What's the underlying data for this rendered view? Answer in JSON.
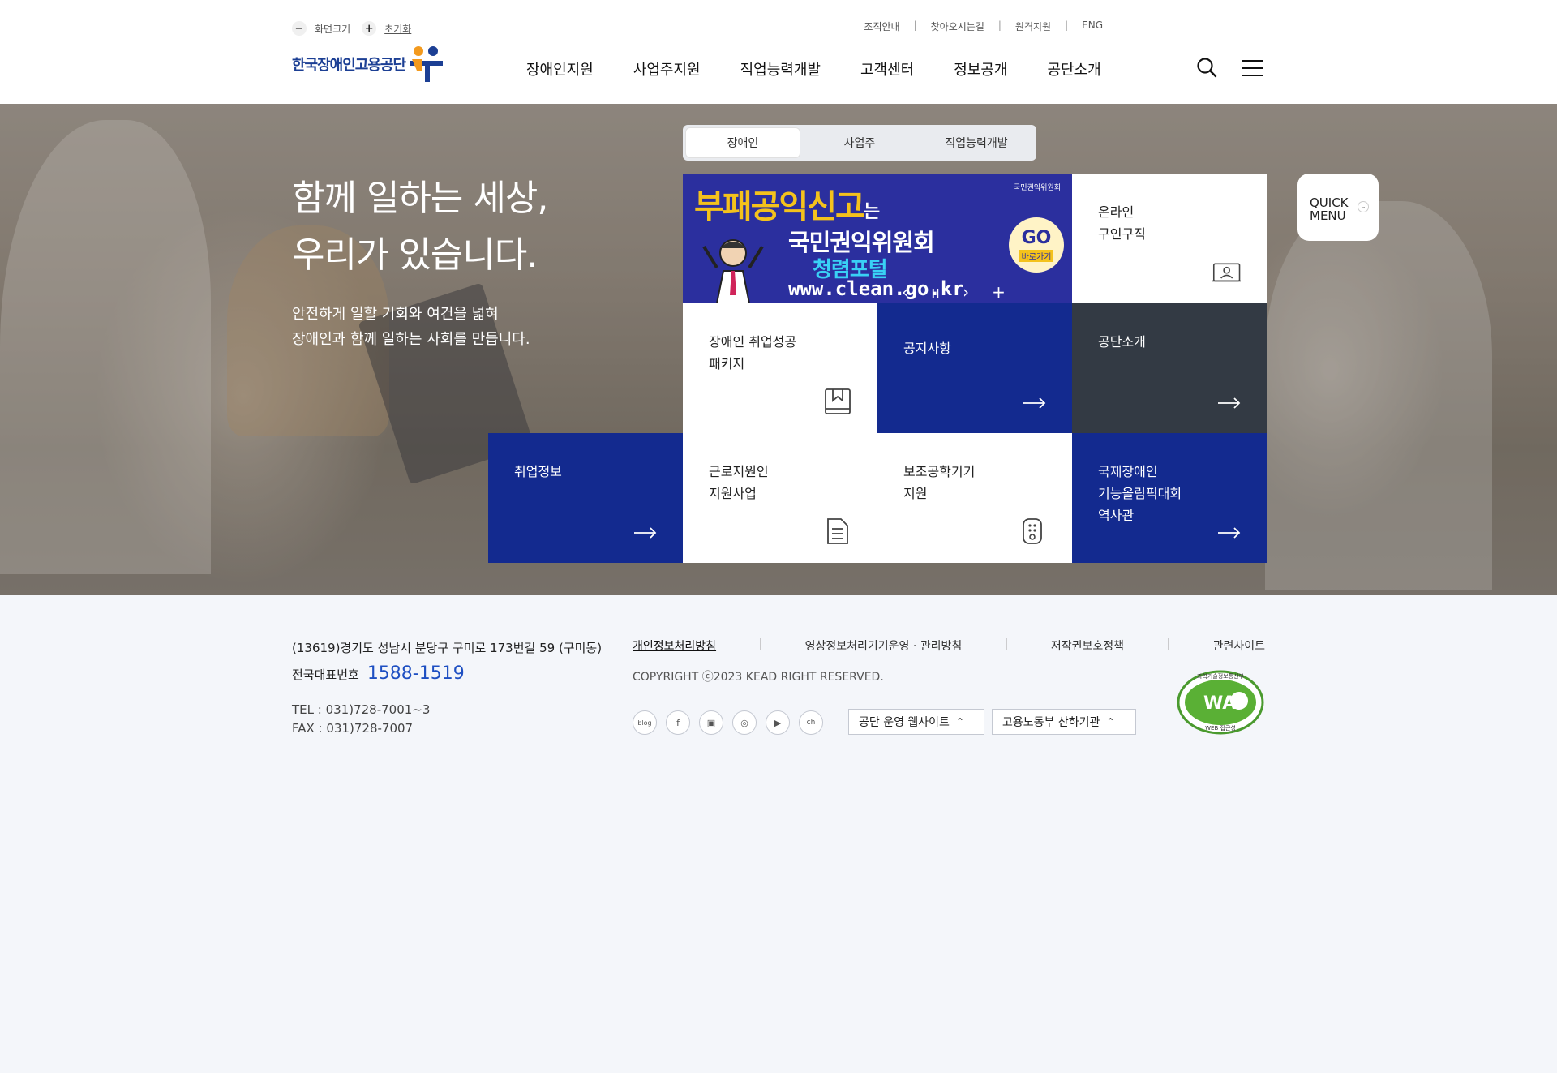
{
  "header": {
    "zoom": {
      "minus": "−",
      "label": "화면크기",
      "plus": "+",
      "reset": "초기화"
    },
    "util_links": [
      "조직안내",
      "찾아오시는길",
      "원격지원",
      "ENG"
    ],
    "logo_text": "한국장애인고용공단",
    "gnb": [
      "장애인지원",
      "사업주지원",
      "직업능력개발",
      "고객센터",
      "정보공개",
      "공단소개"
    ]
  },
  "hero": {
    "title_line1": "함께 일하는 세상,",
    "title_line2": "우리가 있습니다.",
    "desc_line1": "안전하게 일할 기회와 여건을 넓혀",
    "desc_line2": "장애인과 함께 일하는 사회를 만듭니다."
  },
  "tabs": [
    "장애인",
    "사업주",
    "직업능력개발"
  ],
  "banner": {
    "headline": "부패공익신고",
    "headline_suffix": "는",
    "agency": "국민권익위원회",
    "portal": "청렴포털",
    "url": "www.clean.go.kr",
    "agency_logo": "국민권익위원회",
    "go": "GO",
    "go_sub": "바로가기",
    "prev": "‹",
    "pause": "ıı",
    "next": "›",
    "more": "+"
  },
  "tiles": {
    "online_job": [
      "온라인",
      "구인구직"
    ],
    "success_pkg": [
      "장애인 취업성공",
      "패키지"
    ],
    "notice": "공지사항",
    "about": "공단소개",
    "job_info": "취업정보",
    "work_support": [
      "근로지원인",
      "지원사업"
    ],
    "assistive": [
      "보조공학기기",
      "지원"
    ],
    "olympics": [
      "국제장애인",
      "기능올림픽대회",
      "역사관"
    ]
  },
  "quick_menu": {
    "line1": "QUICK",
    "line2": "MENU"
  },
  "footer": {
    "address": "(13619)경기도 성남시 분당구 구미로 173번길 59 (구미동)",
    "rep_label": "전국대표번호",
    "rep_number": "1588-1519",
    "tel": "TEL : 031)728-7001~3",
    "fax": "FAX : 031)728-7007",
    "links": [
      "개인정보처리방침",
      "영상정보처리기기운영 · 관리방침",
      "저작권보호정책",
      "관련사이트"
    ],
    "copyright": "COPYRIGHT ⓒ2023 KEAD RIGHT RESERVED.",
    "social": [
      "blog",
      "f",
      "▣",
      "◎",
      "▶",
      "ch"
    ],
    "select1": "공단 운영 웹사이트",
    "select2": "고용노동부 산하기관",
    "wa_top": "과학기술정보통신부",
    "wa_mark": "WA",
    "wa_bottom": "WEB 접근성"
  },
  "colors": {
    "primary_blue": "#132a8f",
    "dark_tile": "#333a44",
    "accent_number": "#1e4fc2"
  }
}
